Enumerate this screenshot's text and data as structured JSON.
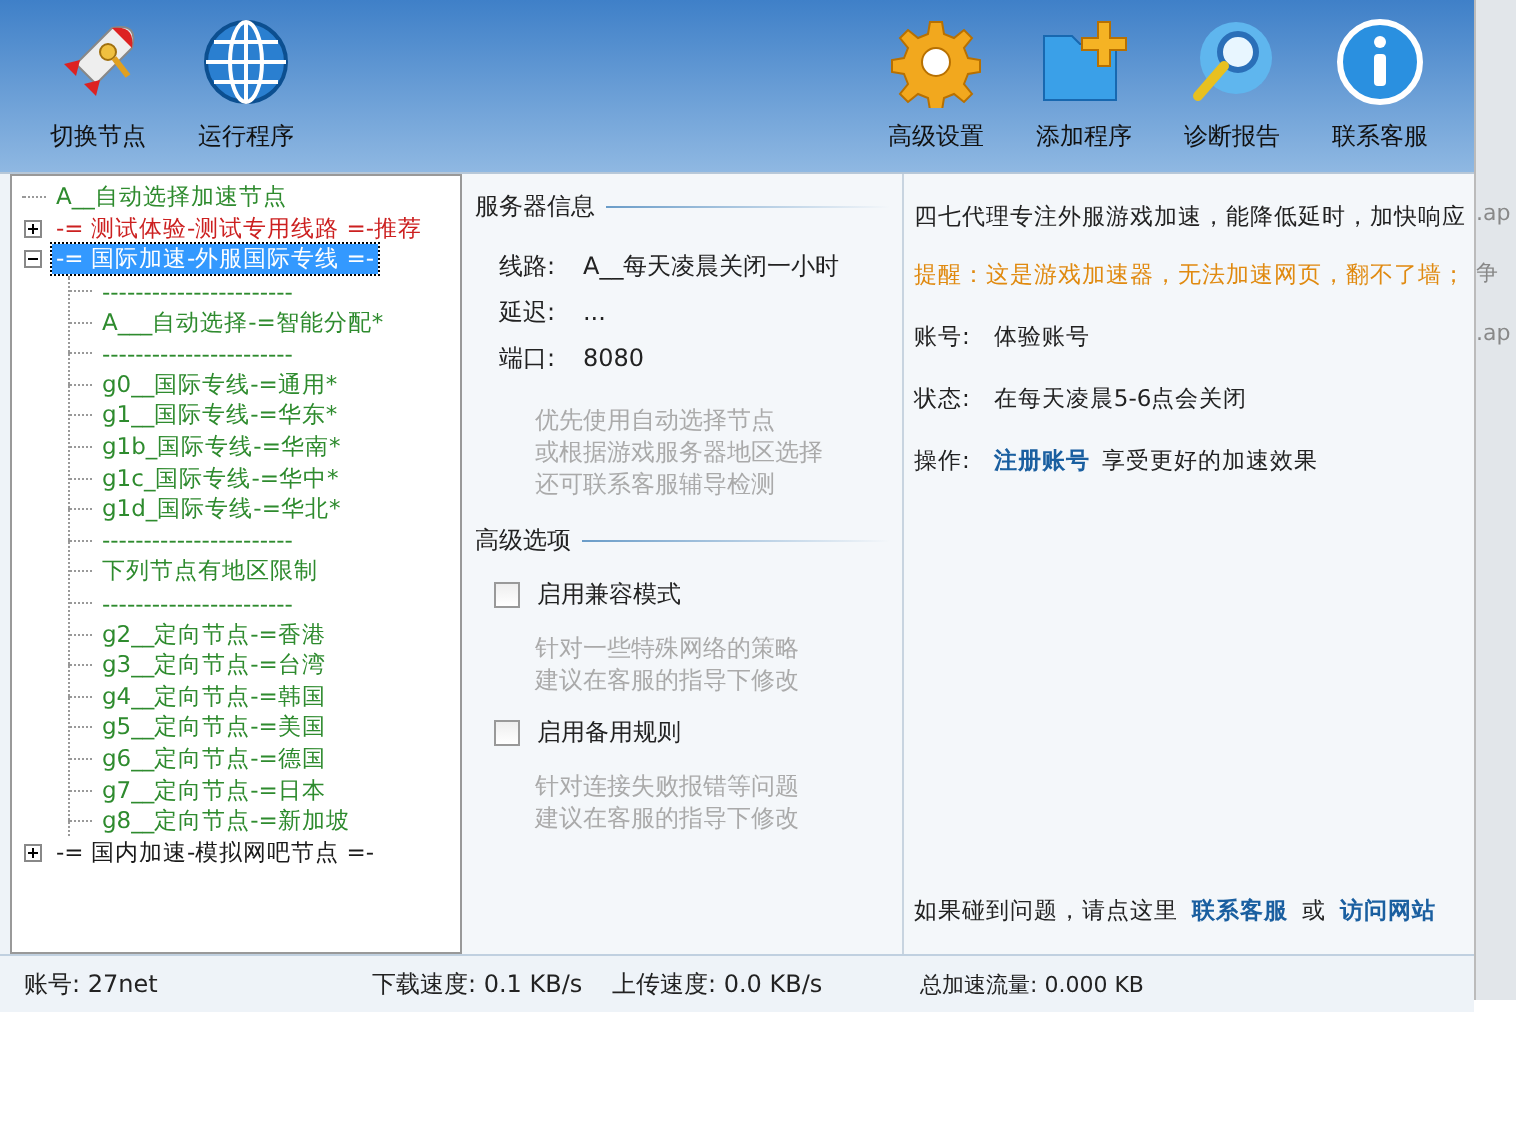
{
  "toolbar": {
    "left": [
      {
        "label": "切换节点"
      },
      {
        "label": "运行程序"
      }
    ],
    "right": [
      {
        "label": "高级设置"
      },
      {
        "label": "添加程序"
      },
      {
        "label": "诊断报告"
      },
      {
        "label": "联系客服"
      }
    ]
  },
  "tree": [
    {
      "label": "A__自动选择加速节点",
      "color": "#2e8b2e",
      "selected": false
    },
    {
      "label": "-= 测试体验-测试专用线路 =-推荐",
      "color": "#cc2020",
      "expanded": false,
      "selected": false
    },
    {
      "label": "-= 国际加速-外服国际专线 =-",
      "expanded": true,
      "selected": true,
      "children": [
        {
          "label": "-----------------------",
          "color": "#2e8b2e"
        },
        {
          "label": "A___自动选择-=智能分配*",
          "color": "#2e8b2e"
        },
        {
          "label": "-----------------------",
          "color": "#2e8b2e"
        },
        {
          "label": "g0__国际专线-=通用*",
          "color": "#2e8b2e"
        },
        {
          "label": "g1__国际专线-=华东*",
          "color": "#2e8b2e"
        },
        {
          "label": "g1b_国际专线-=华南*",
          "color": "#2e8b2e"
        },
        {
          "label": "g1c_国际专线-=华中*",
          "color": "#2e8b2e"
        },
        {
          "label": "g1d_国际专线-=华北*",
          "color": "#2e8b2e"
        },
        {
          "label": "-----------------------",
          "color": "#2e8b2e"
        },
        {
          "label": "下列节点有地区限制",
          "color": "#2e8b2e"
        },
        {
          "label": "-----------------------",
          "color": "#2e8b2e"
        },
        {
          "label": "g2__定向节点-=香港",
          "color": "#2e8b2e"
        },
        {
          "label": "g3__定向节点-=台湾",
          "color": "#2e8b2e"
        },
        {
          "label": "g4__定向节点-=韩国",
          "color": "#2e8b2e"
        },
        {
          "label": "g5__定向节点-=美国",
          "color": "#2e8b2e"
        },
        {
          "label": "g6__定向节点-=德国",
          "color": "#2e8b2e"
        },
        {
          "label": "g7__定向节点-=日本",
          "color": "#2e8b2e"
        },
        {
          "label": "g8__定向节点-=新加坡",
          "color": "#2e8b2e"
        }
      ]
    },
    {
      "label": "-= 国内加速-模拟网吧节点 =-",
      "color": "#1a1a1a",
      "expanded": false,
      "selected": false
    }
  ],
  "server_info": {
    "title": "服务器信息",
    "fields": [
      {
        "label": "线路:",
        "value": "A__每天凌晨关闭一小时"
      },
      {
        "label": "延迟:",
        "value": "..."
      },
      {
        "label": "端口:",
        "value": "8080"
      }
    ],
    "hint": [
      "优先使用自动选择节点",
      "或根据游戏服务器地区选择",
      "还可联系客服辅导检测"
    ]
  },
  "advanced": {
    "title": "高级选项",
    "options": [
      {
        "label": "启用兼容模式",
        "checked": false,
        "hint": [
          "针对一些特殊网络的策略",
          "建议在客服的指导下修改"
        ]
      },
      {
        "label": "启用备用规则",
        "checked": false,
        "hint": [
          "针对连接失败报错等问题",
          "建议在客服的指导下修改"
        ]
      }
    ]
  },
  "info": {
    "intro": "四七代理专注外服游戏加速，能降低延时，加快响应",
    "reminder": "提醒：这是游戏加速器，无法加速网页，翻不了墙；",
    "fields": [
      {
        "label": "账号:",
        "value": "体验账号"
      },
      {
        "label": "状态:",
        "value": "在每天凌晨5-6点会关闭"
      }
    ],
    "operation": {
      "label": "操作:",
      "link": "注册账号",
      "text": "享受更好的加速效果"
    },
    "help": {
      "text": "如果碰到问题，请点这里",
      "link_1": "联系客服",
      "or": "或",
      "link_2": "访问网站"
    }
  },
  "status_bar": {
    "account": "账号: 27net",
    "download": "下载速度: 0.1 KB/s",
    "upload": "上传速度: 0.0 KB/s",
    "traffic": "总加速流量: 0.000 KB"
  },
  "background_window": {
    "texts": [
      ".ap",
      "争",
      ".ap"
    ]
  }
}
